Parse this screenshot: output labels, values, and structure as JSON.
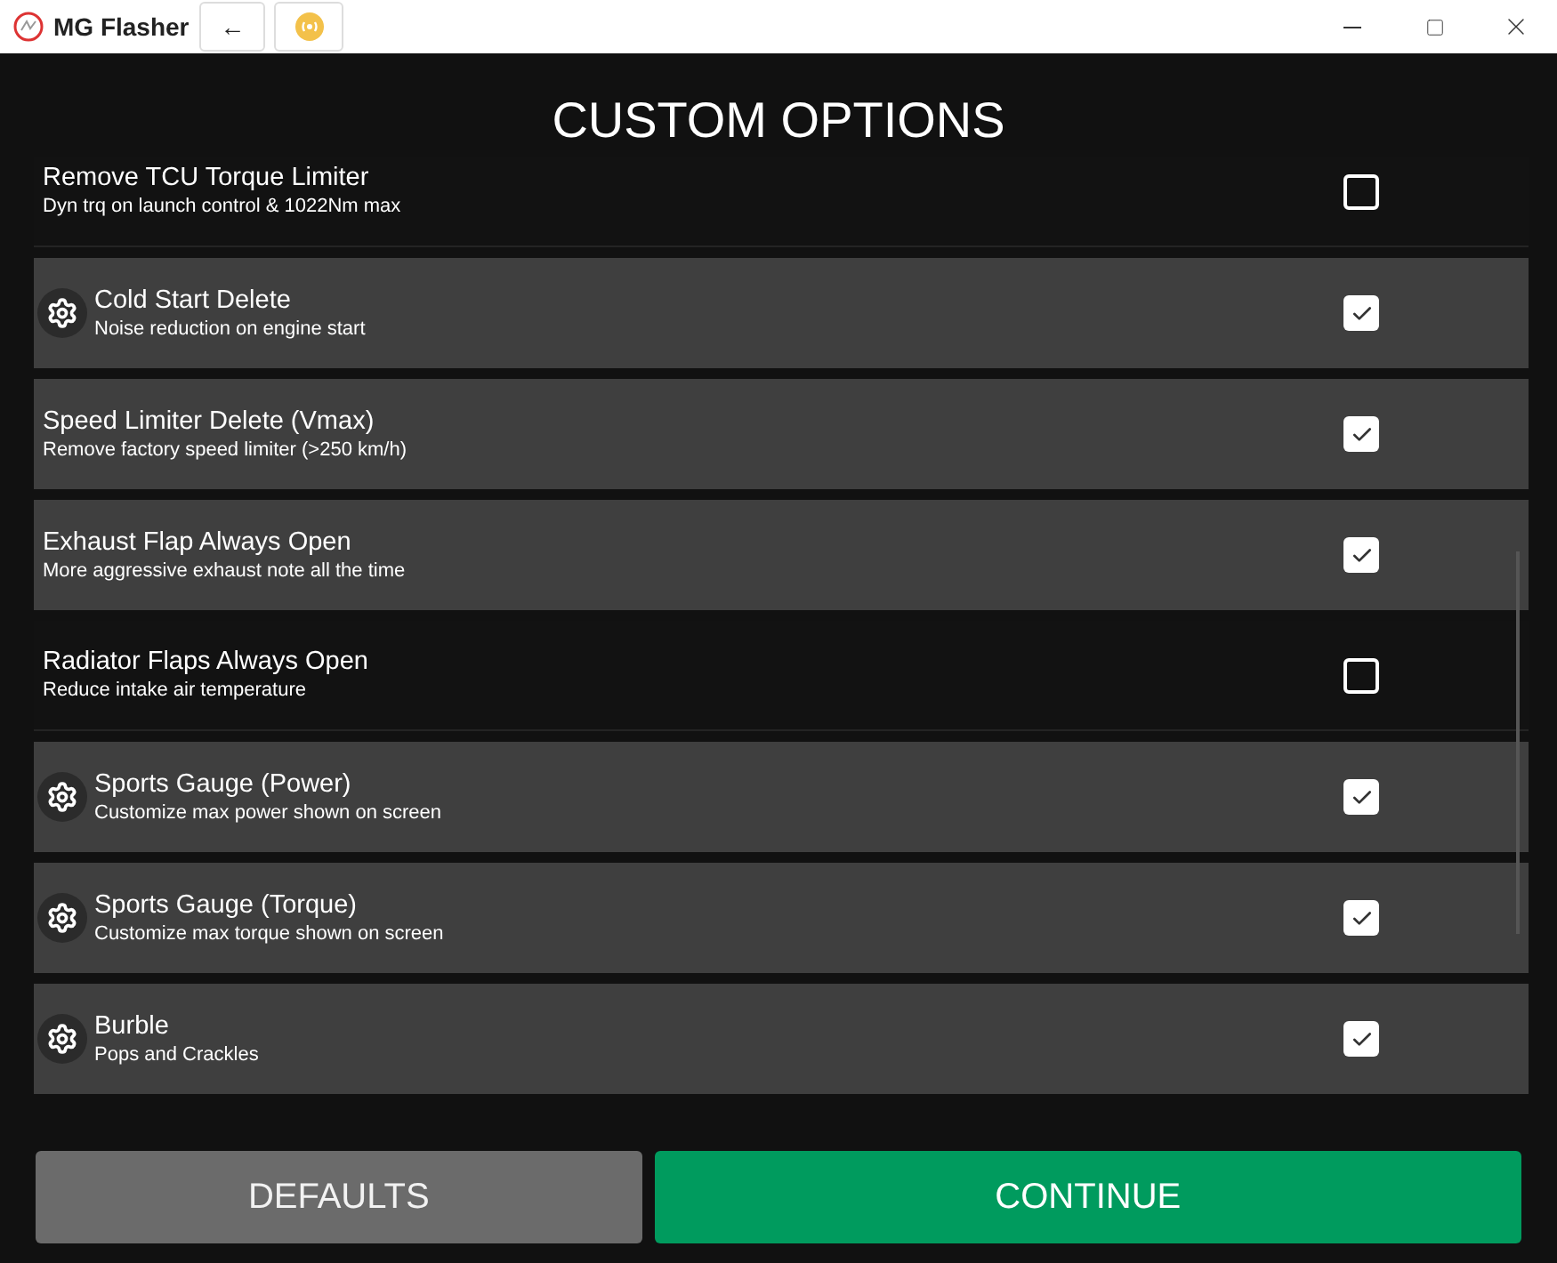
{
  "window": {
    "title": "MG Flasher",
    "back_label": "←"
  },
  "heading": "CUSTOM OPTIONS",
  "options": [
    {
      "title": "Remove TCU Torque Limiter",
      "description": "Dyn trq on launch control & 1022Nm max",
      "checked": false,
      "has_settings": false
    },
    {
      "title": "Cold Start Delete",
      "description": "Noise reduction on engine start",
      "checked": true,
      "has_settings": true
    },
    {
      "title": "Speed Limiter Delete (Vmax)",
      "description": "Remove factory speed limiter (>250 km/h)",
      "checked": true,
      "has_settings": false
    },
    {
      "title": "Exhaust Flap Always Open",
      "description": "More aggressive exhaust note all the time",
      "checked": true,
      "has_settings": false
    },
    {
      "title": "Radiator Flaps Always Open",
      "description": "Reduce intake air temperature",
      "checked": false,
      "has_settings": false
    },
    {
      "title": "Sports Gauge (Power)",
      "description": "Customize max power shown on screen",
      "checked": true,
      "has_settings": true
    },
    {
      "title": "Sports Gauge (Torque)",
      "description": "Customize max torque shown on screen",
      "checked": true,
      "has_settings": true
    },
    {
      "title": "Burble",
      "description": "Pops and Crackles",
      "checked": true,
      "has_settings": true
    }
  ],
  "buttons": [
    {
      "label": "DEFAULTS",
      "kind": "secondary"
    },
    {
      "label": "CONTINUE",
      "kind": "primary"
    }
  ]
}
